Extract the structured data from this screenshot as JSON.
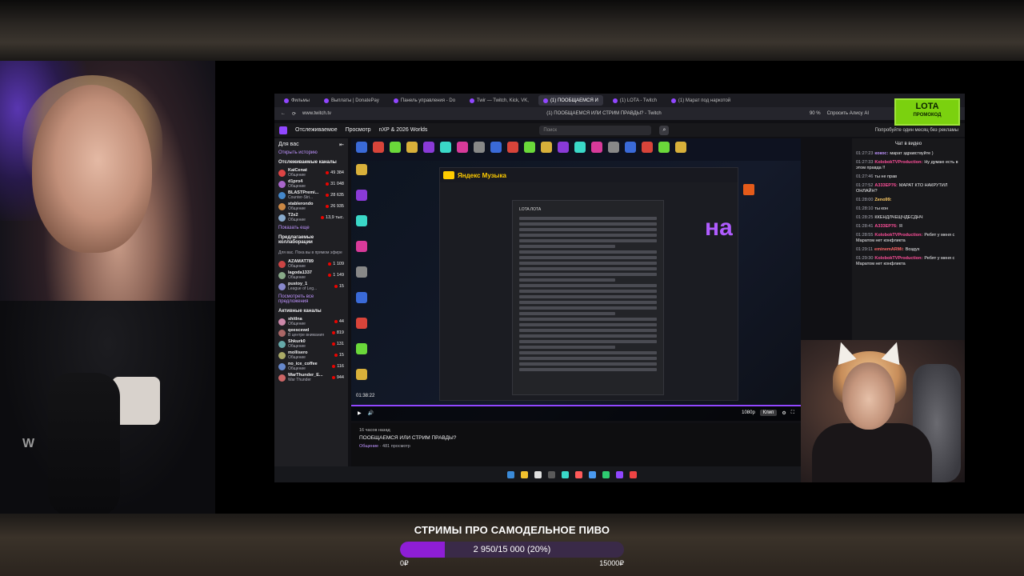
{
  "browser": {
    "tabs": [
      {
        "label": "Фильмы",
        "active": false
      },
      {
        "label": "Выплаты | DonatePay",
        "active": false
      },
      {
        "label": "Панель управления - Do",
        "active": false
      },
      {
        "label": "Twir — Twitch, Kick, VK, ",
        "active": false
      },
      {
        "label": "(1) ПООБЩАЕМСЯ И",
        "active": true
      },
      {
        "label": "(1) LOTA - Twitch",
        "active": false
      },
      {
        "label": "(1) Марат под наркотой",
        "active": false
      }
    ],
    "url": "www.twitch.tv",
    "page_title": "(1) ПООБЩАЕМСЯ ИЛИ СТРИМ ПРАВДЫ? - Twitch",
    "zoom": "90 %",
    "ask_alice": "Спросить Алису AI"
  },
  "ad": {
    "brand": "LOTA",
    "subtitle": "ПРОМОКОД"
  },
  "twitch_nav": {
    "following": "Отслеживаемое",
    "browse": "Просмотр",
    "event": "nXP & 2026 Worlds",
    "search_placeholder": "Поиск",
    "prime_text": "Попробуйте один месяц без рекламы"
  },
  "sidebar": {
    "for_you": "Для вас",
    "open_history": "Открыть историю",
    "followed_title": "Отслеживаемые каналы",
    "followed": [
      {
        "name": "KaiCenat",
        "game": "Общение",
        "viewers": "49 384",
        "color": "#d44"
      },
      {
        "name": "d1pro4",
        "game": "Общение",
        "viewers": "31 048",
        "color": "#a6c"
      },
      {
        "name": "BLASTPremi...",
        "game": "Counter-Stri...",
        "viewers": "28 635",
        "color": "#48c"
      },
      {
        "name": "stablerondo",
        "game": "Общение",
        "viewers": "26 935",
        "color": "#c84"
      },
      {
        "name": "T2x2",
        "game": "Общение",
        "viewers": "13,9 тыс.",
        "color": "#8ac"
      }
    ],
    "show_more": "Показать еще",
    "recommended_title": "Предлагаемые коллаборации",
    "recommended_sub": "Для вас. Пока вы в прямом эфире",
    "recommended": [
      {
        "name": "AZAMAT789",
        "game": "Общение",
        "viewers": "1 109",
        "color": "#c44"
      },
      {
        "name": "lagoda1337",
        "game": "Общение",
        "viewers": "1 149",
        "color": "#8a8"
      },
      {
        "name": "pustoy_1",
        "game": "League of Leg...",
        "viewers": "15",
        "color": "#88c"
      }
    ],
    "see_all": "Посмотреть все предложения",
    "active_title": "Активные каналы",
    "active": [
      {
        "name": "shitlna",
        "game": "Общение",
        "viewers": "44",
        "color": "#c8a"
      },
      {
        "name": "qeescewd",
        "game": "В центре внимания",
        "viewers": "819",
        "color": "#a66"
      },
      {
        "name": "Shkurk0",
        "game": "Общение",
        "viewers": "131",
        "color": "#6aa"
      },
      {
        "name": "mollisero",
        "game": "Общение",
        "viewers": "15",
        "color": "#aa6"
      },
      {
        "name": "no_ice_coffee",
        "game": "Общение",
        "viewers": "116",
        "color": "#68c"
      },
      {
        "name": "WarThunder_E...",
        "game": "War Thunder",
        "viewers": "944",
        "color": "#c66"
      }
    ]
  },
  "player": {
    "music_app": "Яндекс Музыка",
    "editor_title": "LOTA ЛОТА",
    "overlay_text": "на",
    "elapsed": "01:38:22",
    "clip": "Клип",
    "quality": "1080p"
  },
  "stream_info": {
    "ago": "16 часов назад",
    "title": "ПООБЩАЕМСЯ ИЛИ СТРИМ ПРАВДЫ?",
    "category": "Общение",
    "views": "481 просмотр"
  },
  "chat": {
    "header": "Чат в видео",
    "messages": [
      {
        "time": "01:27:23",
        "user": "кокос",
        "text": "марат здравствуйте )",
        "color": "#bf94ff"
      },
      {
        "time": "01:27:33",
        "user": "KolobokTVProduction",
        "text": "Ну думаю есть в этом правда !!",
        "color": "#ff4f9a"
      },
      {
        "time": "01:27:46",
        "user": "",
        "text": "ты не прав",
        "color": "#6af"
      },
      {
        "time": "01:27:52",
        "user": "A333EP76",
        "text": "МАРАТ КТО НАКРУТИЛ ОНЛАЙН?",
        "color": "#ff4f9a"
      },
      {
        "time": "01:28:00",
        "user": "Zeno99",
        "text": "",
        "color": "#fc6"
      },
      {
        "time": "01:28:10",
        "user": "",
        "text": "ты кон",
        "color": "#6af"
      },
      {
        "time": "01:28:25",
        "user": "",
        "text": "ККЕНДЛЧЕЩЧДЕСДНЧ",
        "color": "#6af"
      },
      {
        "time": "01:28:41",
        "user": "A333EP76",
        "text": "Я",
        "color": "#ff4f9a"
      },
      {
        "time": "01:28:55",
        "user": "KolobokTVProduction",
        "text": "Ребят у меня с Маратом нет конфликта",
        "color": "#ff4f9a"
      },
      {
        "time": "01:29:11",
        "user": "eminemARMi",
        "text": "Воздух",
        "color": "#f66"
      },
      {
        "time": "01:29:30",
        "user": "KolobokTVProduction",
        "text": "Ребят у меня с Маратом нет конфликта",
        "color": "#ff4f9a"
      }
    ]
  },
  "goal": {
    "title": "СТРИМЫ ПРО САМОДЕЛЬНОЕ ПИВО",
    "progress_text": "2 950/15 000 (20%)",
    "percent": 20,
    "min_label": "0₽",
    "max_label": "15000₽"
  },
  "colors": {
    "twitch_purple": "#9147ff",
    "goal_fill": "#8e1ed6",
    "ad_green": "#7bd10f"
  }
}
